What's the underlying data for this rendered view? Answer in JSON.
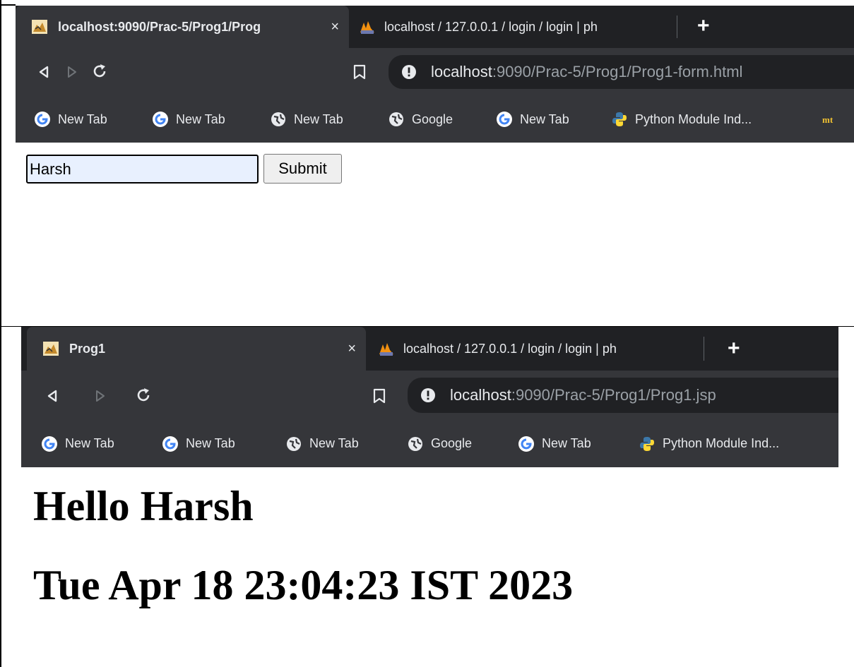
{
  "top_window": {
    "tabs": [
      {
        "title": "localhost:9090/Prac-5/Prog1/Prog",
        "active": true,
        "close": "×",
        "favicon": "tomcat-icon"
      },
      {
        "title": "localhost / 127.0.0.1 / login / login | ph",
        "active": false,
        "favicon": "phpmyadmin-icon"
      }
    ],
    "new_tab": "+",
    "address": {
      "host": "localhost",
      "path": ":9090/Prac-5/Prog1/Prog1-form.html"
    },
    "bookmarks": [
      {
        "label": "New Tab",
        "icon": "google-icon"
      },
      {
        "label": "New Tab",
        "icon": "google-icon"
      },
      {
        "label": "New Tab",
        "icon": "globe-icon"
      },
      {
        "label": "Google",
        "icon": "globe-icon"
      },
      {
        "label": "New Tab",
        "icon": "google-icon"
      },
      {
        "label": "Python Module Ind...",
        "icon": "python-icon"
      },
      {
        "label": "mt",
        "icon": "mt-icon"
      }
    ],
    "form": {
      "input_value": "Harsh",
      "submit_label": "Submit"
    }
  },
  "bottom_window": {
    "tabs": [
      {
        "title": "Prog1",
        "active": true,
        "close": "×",
        "favicon": "tomcat-icon"
      },
      {
        "title": "localhost / 127.0.0.1 / login / login | ph",
        "active": false,
        "favicon": "phpmyadmin-icon"
      }
    ],
    "new_tab": "+",
    "address": {
      "host": "localhost",
      "path": ":9090/Prac-5/Prog1/Prog1.jsp"
    },
    "bookmarks": [
      {
        "label": "New Tab",
        "icon": "google-icon"
      },
      {
        "label": "New Tab",
        "icon": "google-icon"
      },
      {
        "label": "New Tab",
        "icon": "globe-icon"
      },
      {
        "label": "Google",
        "icon": "globe-icon"
      },
      {
        "label": "New Tab",
        "icon": "google-icon"
      },
      {
        "label": "Python Module Ind...",
        "icon": "python-icon"
      }
    ],
    "page": {
      "greeting": "Hello Harsh",
      "timestamp": "Tue Apr 18 23:04:23 IST 2023"
    }
  },
  "colors": {
    "tabstrip": "#202124",
    "toolbar": "#35363a",
    "omnibox": "#202124",
    "text": "#e8eaed",
    "url_dim": "#9aa0a6",
    "autofill": "#e8f0fe"
  }
}
